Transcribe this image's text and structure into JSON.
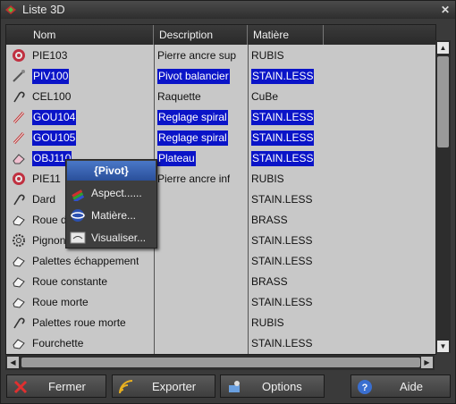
{
  "window": {
    "title": "Liste 3D",
    "close_glyph": "✕"
  },
  "columns": [
    "Nom",
    "Description",
    "Matière"
  ],
  "rows": [
    {
      "icon": "jewel-icon",
      "name": "PIE103",
      "description": "Pierre ancre sup",
      "matiere": "RUBIS",
      "selected": false
    },
    {
      "icon": "pivot-icon",
      "name": "PIV100",
      "description": "Pivot balancier",
      "matiere": "STAIN.LESS",
      "selected": true
    },
    {
      "icon": "hook-icon",
      "name": "CEL100",
      "description": "Raquette",
      "matiere": "CuBe",
      "selected": false
    },
    {
      "icon": "pin-icon",
      "name": "GOU104",
      "description": "Reglage spiral",
      "matiere": "STAIN.LESS",
      "selected": true
    },
    {
      "icon": "pin-icon",
      "name": "GOU105",
      "description": "Reglage spiral",
      "matiere": "STAIN.LESS",
      "selected": true
    },
    {
      "icon": "eraser-icon",
      "name": "OBJ110",
      "description": "Plateau",
      "matiere": "STAIN.LESS",
      "selected": true
    },
    {
      "icon": "jewel-icon",
      "name": "PIE11",
      "description": "Pierre ancre inf",
      "matiere": "RUBIS",
      "selected": false
    },
    {
      "icon": "hook-icon",
      "name": "Dard",
      "description": "",
      "matiere": "STAIN.LESS",
      "selected": false
    },
    {
      "icon": "part-icon",
      "name": "Roue d",
      "description": "",
      "matiere": "BRASS",
      "selected": false
    },
    {
      "icon": "gear-icon",
      "name": "Pignon",
      "description": "",
      "matiere": "STAIN.LESS",
      "selected": false
    },
    {
      "icon": "part-icon",
      "name": "Palettes échappement",
      "description": "",
      "matiere": "STAIN.LESS",
      "selected": false
    },
    {
      "icon": "part-icon",
      "name": "Roue constante",
      "description": "",
      "matiere": "BRASS",
      "selected": false
    },
    {
      "icon": "part-icon",
      "name": "Roue morte",
      "description": "",
      "matiere": "STAIN.LESS",
      "selected": false
    },
    {
      "icon": "hook-icon",
      "name": "Palettes roue morte",
      "description": "",
      "matiere": "RUBIS",
      "selected": false
    },
    {
      "icon": "part-icon",
      "name": "Fourchette",
      "description": "",
      "matiere": "STAIN.LESS",
      "selected": false
    }
  ],
  "context_menu": {
    "header": "{Pivot}",
    "items": [
      {
        "label": "Aspect......",
        "icon": "palette-icon"
      },
      {
        "label": "Matière...",
        "icon": "material-sphere-icon"
      },
      {
        "label": "Visualiser...",
        "icon": "preview-icon"
      }
    ]
  },
  "buttons": [
    {
      "label": "Fermer",
      "icon": "close-x-icon"
    },
    {
      "label": "Exporter",
      "icon": "export-icon"
    },
    {
      "label": "Options",
      "icon": "options-icon"
    },
    {
      "label": "Aide",
      "icon": "help-icon"
    }
  ],
  "colors": {
    "selection": "#0a14c8",
    "list_bg": "#c8c8c8",
    "window_bg": "#3a3a3a"
  }
}
